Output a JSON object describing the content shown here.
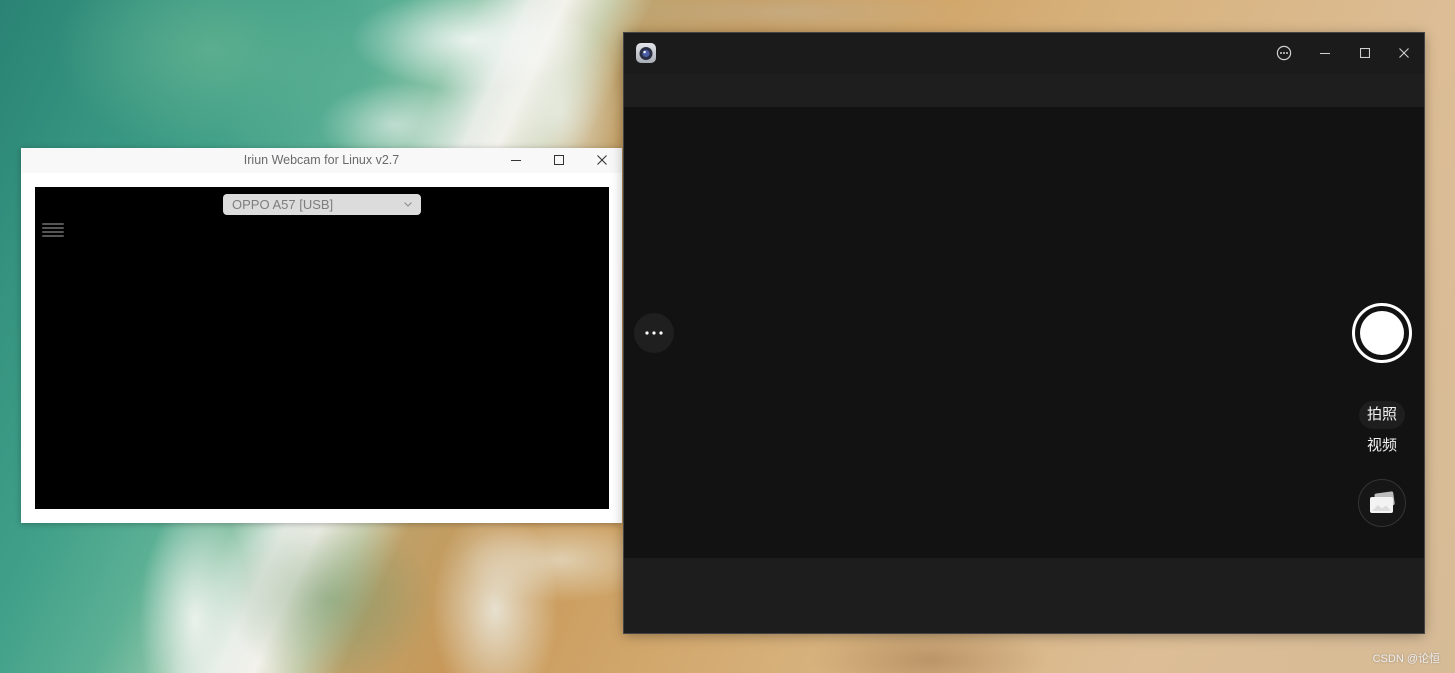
{
  "theme": {
    "camera-titlebar": "#1b1b1b",
    "camera-toolbar": "#1e1e1e",
    "camera-preview": "#121212",
    "camera-bottom-bar": "#1d1d1d",
    "iriun-video": "#000000"
  },
  "desktop": {
    "watermark": "CSDN @论恒"
  },
  "iriun_window": {
    "title": "Iriun Webcam for Linux v2.7",
    "window_controls": [
      "minimize-icon",
      "maximize-icon",
      "close-icon"
    ],
    "device_select": {
      "selected": "OPPO A57 [USB]",
      "icon": "chevron-down-icon"
    },
    "menu_icon": "hamburger-menu-icon"
  },
  "camera_window": {
    "app_icon": "camera-app-icon",
    "window_controls": [
      "more-menu-icon",
      "minimize-icon",
      "maximize-icon",
      "close-icon"
    ],
    "side_button_icon": "more-horizontal-icon",
    "shutter_icon": "shutter-icon",
    "modes": [
      {
        "label": "拍照",
        "selected": true
      },
      {
        "label": "视频",
        "selected": false
      }
    ],
    "gallery_icon": "photo-gallery-icon"
  }
}
